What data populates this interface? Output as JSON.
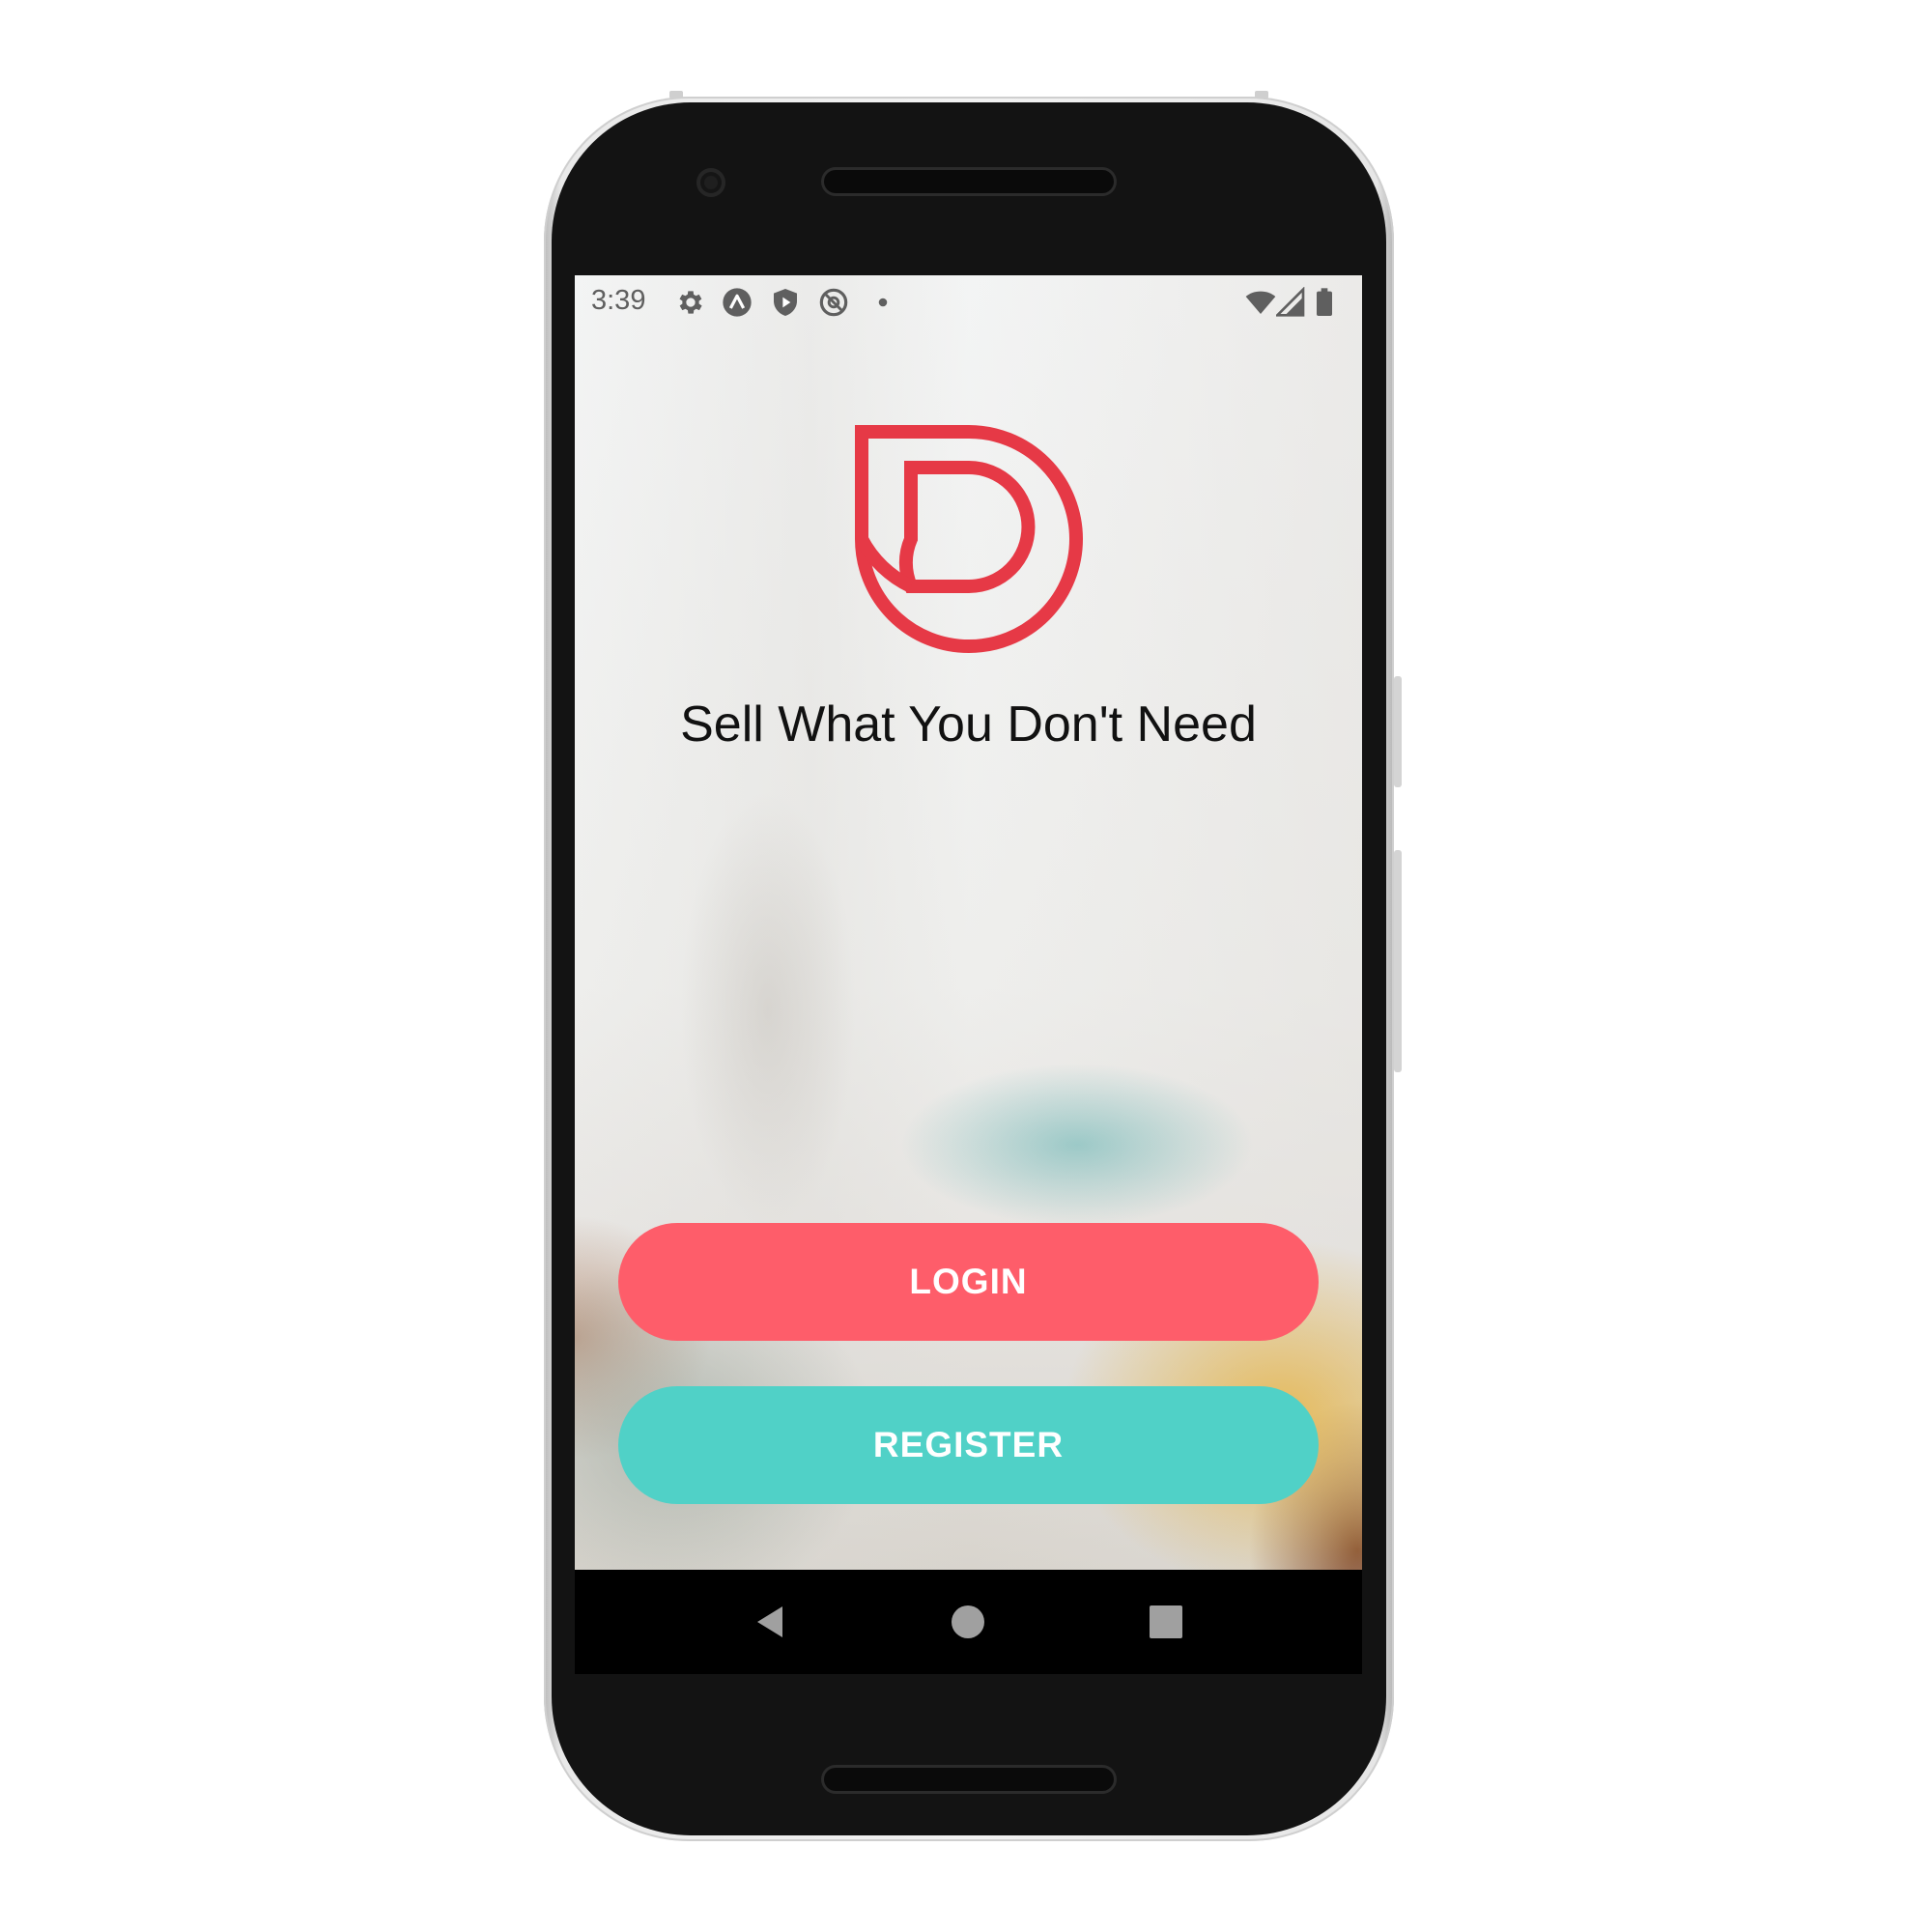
{
  "colors": {
    "brand_red": "#e63946",
    "login_button": "#fe5d6a",
    "register_button": "#50d1c7",
    "status_icons": "#5f5f5f",
    "nav_icons": "#a0a0a0"
  },
  "status_bar": {
    "time": "3:39",
    "left_icons": [
      "gear-icon",
      "expo-icon",
      "shield-play-icon",
      "at-sign-icon",
      "notification-dot-icon"
    ],
    "right_icons": [
      "wifi-icon",
      "cellular-signal-icon",
      "battery-icon"
    ]
  },
  "app": {
    "logo": "brand-d-logo-icon",
    "tagline": "Sell What You Don't Need",
    "login_label": "LOGIN",
    "register_label": "REGISTER"
  },
  "nav_bar": {
    "icons": [
      "back-triangle-icon",
      "home-circle-icon",
      "recents-square-icon"
    ]
  }
}
